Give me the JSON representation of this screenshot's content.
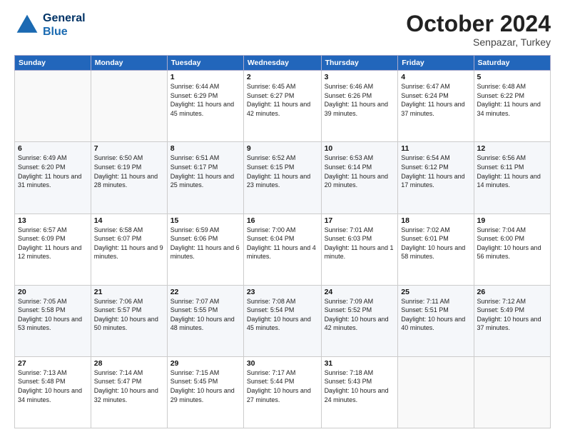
{
  "header": {
    "logo_line1": "General",
    "logo_line2": "Blue",
    "month": "October 2024",
    "location": "Senpazar, Turkey"
  },
  "days_of_week": [
    "Sunday",
    "Monday",
    "Tuesday",
    "Wednesday",
    "Thursday",
    "Friday",
    "Saturday"
  ],
  "weeks": [
    [
      {
        "day": "",
        "sunrise": "",
        "sunset": "",
        "daylight": ""
      },
      {
        "day": "",
        "sunrise": "",
        "sunset": "",
        "daylight": ""
      },
      {
        "day": "1",
        "sunrise": "Sunrise: 6:44 AM",
        "sunset": "Sunset: 6:29 PM",
        "daylight": "Daylight: 11 hours and 45 minutes."
      },
      {
        "day": "2",
        "sunrise": "Sunrise: 6:45 AM",
        "sunset": "Sunset: 6:27 PM",
        "daylight": "Daylight: 11 hours and 42 minutes."
      },
      {
        "day": "3",
        "sunrise": "Sunrise: 6:46 AM",
        "sunset": "Sunset: 6:26 PM",
        "daylight": "Daylight: 11 hours and 39 minutes."
      },
      {
        "day": "4",
        "sunrise": "Sunrise: 6:47 AM",
        "sunset": "Sunset: 6:24 PM",
        "daylight": "Daylight: 11 hours and 37 minutes."
      },
      {
        "day": "5",
        "sunrise": "Sunrise: 6:48 AM",
        "sunset": "Sunset: 6:22 PM",
        "daylight": "Daylight: 11 hours and 34 minutes."
      }
    ],
    [
      {
        "day": "6",
        "sunrise": "Sunrise: 6:49 AM",
        "sunset": "Sunset: 6:20 PM",
        "daylight": "Daylight: 11 hours and 31 minutes."
      },
      {
        "day": "7",
        "sunrise": "Sunrise: 6:50 AM",
        "sunset": "Sunset: 6:19 PM",
        "daylight": "Daylight: 11 hours and 28 minutes."
      },
      {
        "day": "8",
        "sunrise": "Sunrise: 6:51 AM",
        "sunset": "Sunset: 6:17 PM",
        "daylight": "Daylight: 11 hours and 25 minutes."
      },
      {
        "day": "9",
        "sunrise": "Sunrise: 6:52 AM",
        "sunset": "Sunset: 6:15 PM",
        "daylight": "Daylight: 11 hours and 23 minutes."
      },
      {
        "day": "10",
        "sunrise": "Sunrise: 6:53 AM",
        "sunset": "Sunset: 6:14 PM",
        "daylight": "Daylight: 11 hours and 20 minutes."
      },
      {
        "day": "11",
        "sunrise": "Sunrise: 6:54 AM",
        "sunset": "Sunset: 6:12 PM",
        "daylight": "Daylight: 11 hours and 17 minutes."
      },
      {
        "day": "12",
        "sunrise": "Sunrise: 6:56 AM",
        "sunset": "Sunset: 6:11 PM",
        "daylight": "Daylight: 11 hours and 14 minutes."
      }
    ],
    [
      {
        "day": "13",
        "sunrise": "Sunrise: 6:57 AM",
        "sunset": "Sunset: 6:09 PM",
        "daylight": "Daylight: 11 hours and 12 minutes."
      },
      {
        "day": "14",
        "sunrise": "Sunrise: 6:58 AM",
        "sunset": "Sunset: 6:07 PM",
        "daylight": "Daylight: 11 hours and 9 minutes."
      },
      {
        "day": "15",
        "sunrise": "Sunrise: 6:59 AM",
        "sunset": "Sunset: 6:06 PM",
        "daylight": "Daylight: 11 hours and 6 minutes."
      },
      {
        "day": "16",
        "sunrise": "Sunrise: 7:00 AM",
        "sunset": "Sunset: 6:04 PM",
        "daylight": "Daylight: 11 hours and 4 minutes."
      },
      {
        "day": "17",
        "sunrise": "Sunrise: 7:01 AM",
        "sunset": "Sunset: 6:03 PM",
        "daylight": "Daylight: 11 hours and 1 minute."
      },
      {
        "day": "18",
        "sunrise": "Sunrise: 7:02 AM",
        "sunset": "Sunset: 6:01 PM",
        "daylight": "Daylight: 10 hours and 58 minutes."
      },
      {
        "day": "19",
        "sunrise": "Sunrise: 7:04 AM",
        "sunset": "Sunset: 6:00 PM",
        "daylight": "Daylight: 10 hours and 56 minutes."
      }
    ],
    [
      {
        "day": "20",
        "sunrise": "Sunrise: 7:05 AM",
        "sunset": "Sunset: 5:58 PM",
        "daylight": "Daylight: 10 hours and 53 minutes."
      },
      {
        "day": "21",
        "sunrise": "Sunrise: 7:06 AM",
        "sunset": "Sunset: 5:57 PM",
        "daylight": "Daylight: 10 hours and 50 minutes."
      },
      {
        "day": "22",
        "sunrise": "Sunrise: 7:07 AM",
        "sunset": "Sunset: 5:55 PM",
        "daylight": "Daylight: 10 hours and 48 minutes."
      },
      {
        "day": "23",
        "sunrise": "Sunrise: 7:08 AM",
        "sunset": "Sunset: 5:54 PM",
        "daylight": "Daylight: 10 hours and 45 minutes."
      },
      {
        "day": "24",
        "sunrise": "Sunrise: 7:09 AM",
        "sunset": "Sunset: 5:52 PM",
        "daylight": "Daylight: 10 hours and 42 minutes."
      },
      {
        "day": "25",
        "sunrise": "Sunrise: 7:11 AM",
        "sunset": "Sunset: 5:51 PM",
        "daylight": "Daylight: 10 hours and 40 minutes."
      },
      {
        "day": "26",
        "sunrise": "Sunrise: 7:12 AM",
        "sunset": "Sunset: 5:49 PM",
        "daylight": "Daylight: 10 hours and 37 minutes."
      }
    ],
    [
      {
        "day": "27",
        "sunrise": "Sunrise: 7:13 AM",
        "sunset": "Sunset: 5:48 PM",
        "daylight": "Daylight: 10 hours and 34 minutes."
      },
      {
        "day": "28",
        "sunrise": "Sunrise: 7:14 AM",
        "sunset": "Sunset: 5:47 PM",
        "daylight": "Daylight: 10 hours and 32 minutes."
      },
      {
        "day": "29",
        "sunrise": "Sunrise: 7:15 AM",
        "sunset": "Sunset: 5:45 PM",
        "daylight": "Daylight: 10 hours and 29 minutes."
      },
      {
        "day": "30",
        "sunrise": "Sunrise: 7:17 AM",
        "sunset": "Sunset: 5:44 PM",
        "daylight": "Daylight: 10 hours and 27 minutes."
      },
      {
        "day": "31",
        "sunrise": "Sunrise: 7:18 AM",
        "sunset": "Sunset: 5:43 PM",
        "daylight": "Daylight: 10 hours and 24 minutes."
      },
      {
        "day": "",
        "sunrise": "",
        "sunset": "",
        "daylight": ""
      },
      {
        "day": "",
        "sunrise": "",
        "sunset": "",
        "daylight": ""
      }
    ]
  ]
}
